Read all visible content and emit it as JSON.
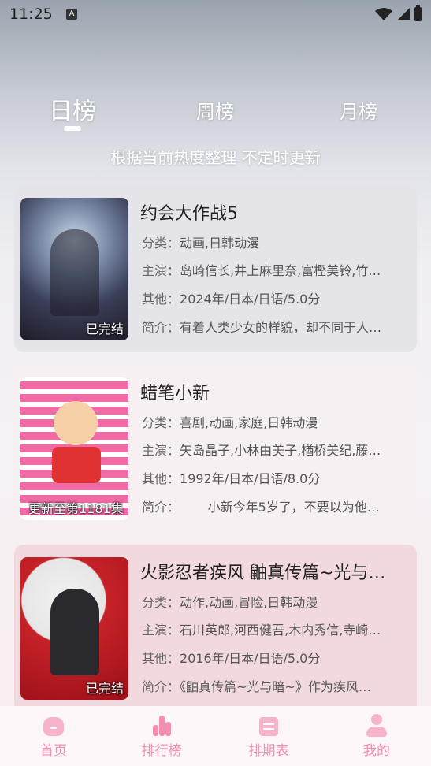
{
  "status_bar": {
    "time": "11:25",
    "badge": "A"
  },
  "tabs": [
    {
      "label": "日榜",
      "active": true
    },
    {
      "label": "周榜",
      "active": false
    },
    {
      "label": "月榜",
      "active": false
    }
  ],
  "subtitle": "根据当前热度整理 不定时更新",
  "items": [
    {
      "title": "约会大作战5",
      "poster_tag": "已完结",
      "category_label": "分类：",
      "category": "动画,日韩动漫",
      "cast_label": "主演：",
      "cast": "岛崎信长,井上麻里奈,富樫美铃,竹…",
      "other_label": "其他：",
      "other": "2024年/日本/日语/5.0分",
      "intro_label": "简介：",
      "intro": "有着人类少女的样貌，却不同于人…"
    },
    {
      "title": "蜡笔小新",
      "poster_tag": "更新至第1181集",
      "category_label": "分类：",
      "category": "喜剧,动画,家庭,日韩动漫",
      "cast_label": "主演：",
      "cast": "矢岛晶子,小林由美子,楢桥美纪,藤…",
      "other_label": "其他：",
      "other": "1992年/日本/日语/8.0分",
      "intro_label": "简介：",
      "intro": "       小新今年5岁了，不要以为他…"
    },
    {
      "title": "火影忍者疾风 鼬真传篇~光与…",
      "poster_tag": "已完结",
      "category_label": "分类：",
      "category": "动作,动画,冒险,日韩动漫",
      "cast_label": "主演：",
      "cast": "石川英郎,河西健吾,木内秀信,寺崎…",
      "other_label": "其他：",
      "other": "2016年/日本/日语/5.0分",
      "intro_label": "简介：",
      "intro": "《鼬真传篇~光与暗~》作为疾风…"
    }
  ],
  "nav": [
    {
      "label": "首页",
      "icon": "home-icon"
    },
    {
      "label": "排行榜",
      "icon": "ranking-icon"
    },
    {
      "label": "排期表",
      "icon": "calendar-icon"
    },
    {
      "label": "我的",
      "icon": "profile-icon"
    }
  ],
  "colors": {
    "accent": "#f48fb1",
    "tab_text": "#ffffff"
  }
}
